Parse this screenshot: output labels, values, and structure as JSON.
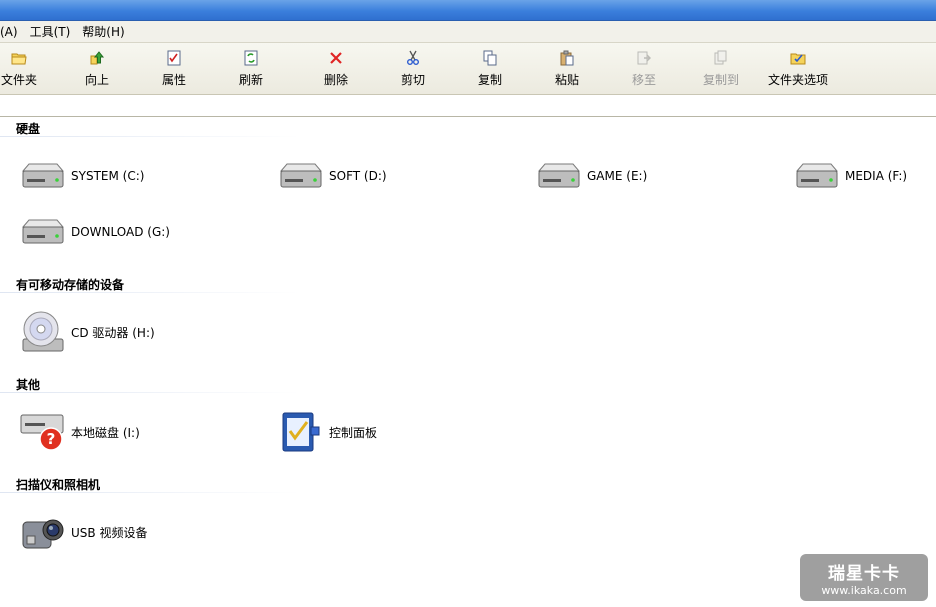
{
  "menu": [
    {
      "label": "(A)"
    },
    {
      "label": "工具(T)"
    },
    {
      "label": "帮助(H)"
    }
  ],
  "toolbar": [
    {
      "label": "文件夹",
      "icon": "folder-icon",
      "enabled": true
    },
    {
      "label": "向上",
      "icon": "up-arrow-icon",
      "enabled": true
    },
    {
      "label": "属性",
      "icon": "properties-icon",
      "enabled": true
    },
    {
      "label": "刷新",
      "icon": "refresh-icon",
      "enabled": true
    },
    {
      "label": "删除",
      "icon": "delete-x-icon",
      "enabled": true
    },
    {
      "label": "剪切",
      "icon": "scissors-icon",
      "enabled": true
    },
    {
      "label": "复制",
      "icon": "copy-icon",
      "enabled": true
    },
    {
      "label": "粘贴",
      "icon": "paste-icon",
      "enabled": true
    },
    {
      "label": "移至",
      "icon": "move-to-icon",
      "enabled": false
    },
    {
      "label": "复制到",
      "icon": "copy-to-icon",
      "enabled": false
    },
    {
      "label": "文件夹选项",
      "icon": "folder-options-icon",
      "enabled": true
    }
  ],
  "groups": {
    "hard_disks": {
      "title": "硬盘",
      "items": [
        {
          "label": "SYSTEM (C:)",
          "icon": "hard-drive-icon"
        },
        {
          "label": "SOFT (D:)",
          "icon": "hard-drive-icon"
        },
        {
          "label": "GAME (E:)",
          "icon": "hard-drive-icon"
        },
        {
          "label": "MEDIA (F:)",
          "icon": "hard-drive-icon"
        },
        {
          "label": "DOWNLOAD (G:)",
          "icon": "hard-drive-icon"
        }
      ]
    },
    "removable": {
      "title": "有可移动存储的设备",
      "items": [
        {
          "label": "CD 驱动器 (H:)",
          "icon": "cd-drive-icon"
        }
      ]
    },
    "other": {
      "title": "其他",
      "items": [
        {
          "label": "本地磁盘 (I:)",
          "icon": "unknown-drive-icon"
        },
        {
          "label": "控制面板",
          "icon": "control-panel-icon"
        }
      ]
    },
    "scanners": {
      "title": "扫描仪和照相机",
      "items": [
        {
          "label": "USB 视频设备",
          "icon": "camera-icon"
        }
      ]
    }
  },
  "watermark": {
    "title": "瑞星卡卡",
    "url": "www.ikaka.com"
  }
}
